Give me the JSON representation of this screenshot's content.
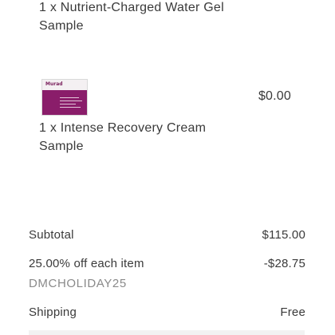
{
  "cart": {
    "items": [
      {
        "name_line1": "1 x Nutrient-Charged Water Gel",
        "name_line2": "Sample",
        "price": ""
      },
      {
        "name_line1": "1 x Intense Recovery Cream",
        "name_line2": "Sample",
        "price": "$0.00",
        "thumbnail": {
          "icon": "product-sample-packet-icon",
          "brand_text": "Murad",
          "colors": {
            "band": "#8a1d6a",
            "top": "#f4f0f2"
          }
        }
      }
    ]
  },
  "summary": {
    "subtotal_label": "Subtotal",
    "subtotal_value": "$115.00",
    "discount_label": "25.00% off each item",
    "discount_value": "-$28.75",
    "promo_code": "DMCHOLIDAY25",
    "shipping_label": "Shipping",
    "shipping_value": "Free"
  },
  "colors": {
    "text": "#3a3a3a",
    "muted": "#8a8a8a",
    "background": "#ffffff"
  }
}
